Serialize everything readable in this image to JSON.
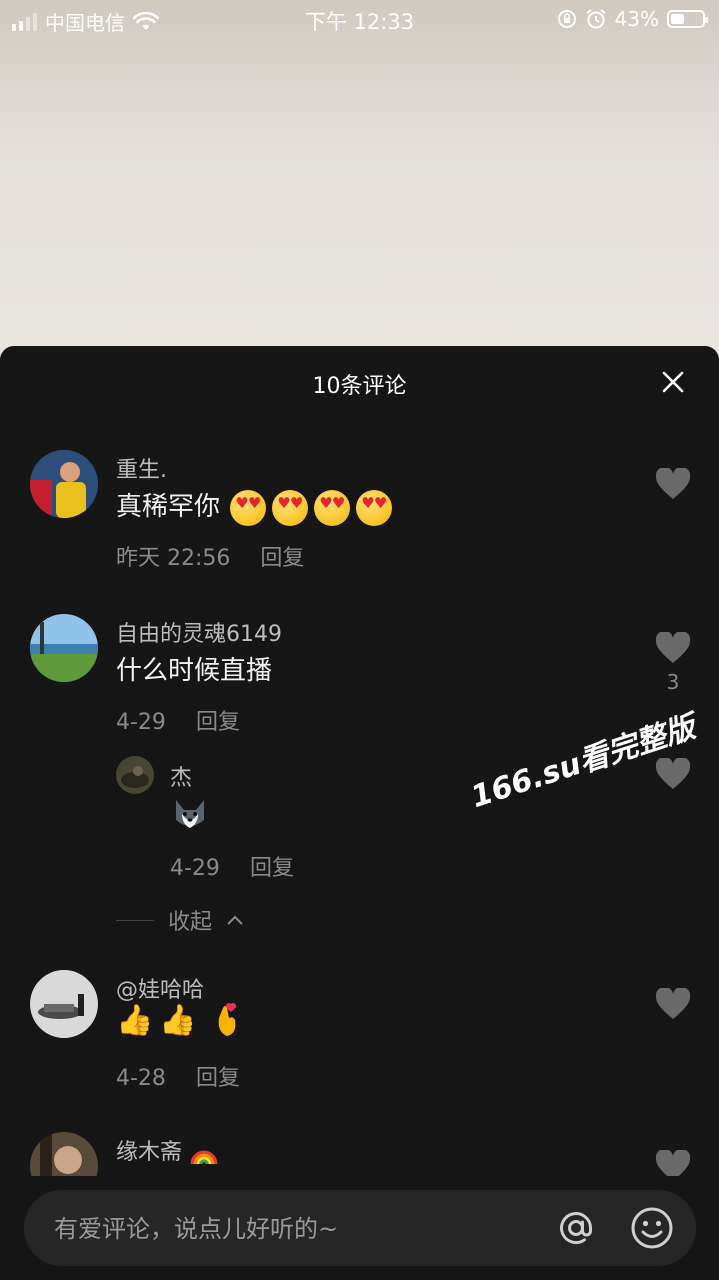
{
  "status_bar": {
    "carrier": "中国电信",
    "time": "下午 12:33",
    "battery": "43%",
    "battery_level": 0.43
  },
  "panel": {
    "title": "10条评论",
    "close_icon": "close-icon"
  },
  "comments": [
    {
      "user": "重生.",
      "text": "真稀罕你",
      "emoji": [
        "heart-eyes-emoji",
        "heart-eyes-emoji",
        "heart-eyes-emoji",
        "heart-eyes-emoji"
      ],
      "date": "昨天 22:56",
      "reply": "回复",
      "likes": ""
    },
    {
      "user": "自由的灵魂6149",
      "text": "什么时候直播",
      "date": "4-29",
      "reply": "回复",
      "likes": "3",
      "sub_replies": [
        {
          "user": "杰",
          "emoji": "husky-dog-emoji",
          "date": "4-29",
          "reply": "回复"
        }
      ],
      "collapse_label": "收起"
    },
    {
      "user": "@娃哈哈",
      "emoji": [
        "thumbs-up-emoji",
        "thumbs-up-emoji",
        "finger-heart-emoji"
      ],
      "date": "4-28",
      "reply": "回复",
      "likes": ""
    },
    {
      "user": "缘木斋",
      "emoji": [
        "rainbow-emoji"
      ],
      "likes": ""
    }
  ],
  "watermark": "166.su看完整版",
  "input": {
    "placeholder": "有爱评论，说点儿好听的~"
  },
  "colors": {
    "panel_bg": "#161616",
    "input_bg": "#262626",
    "secondary_text": "#8a8a8a",
    "heart_gray": "#6a6a6a"
  }
}
